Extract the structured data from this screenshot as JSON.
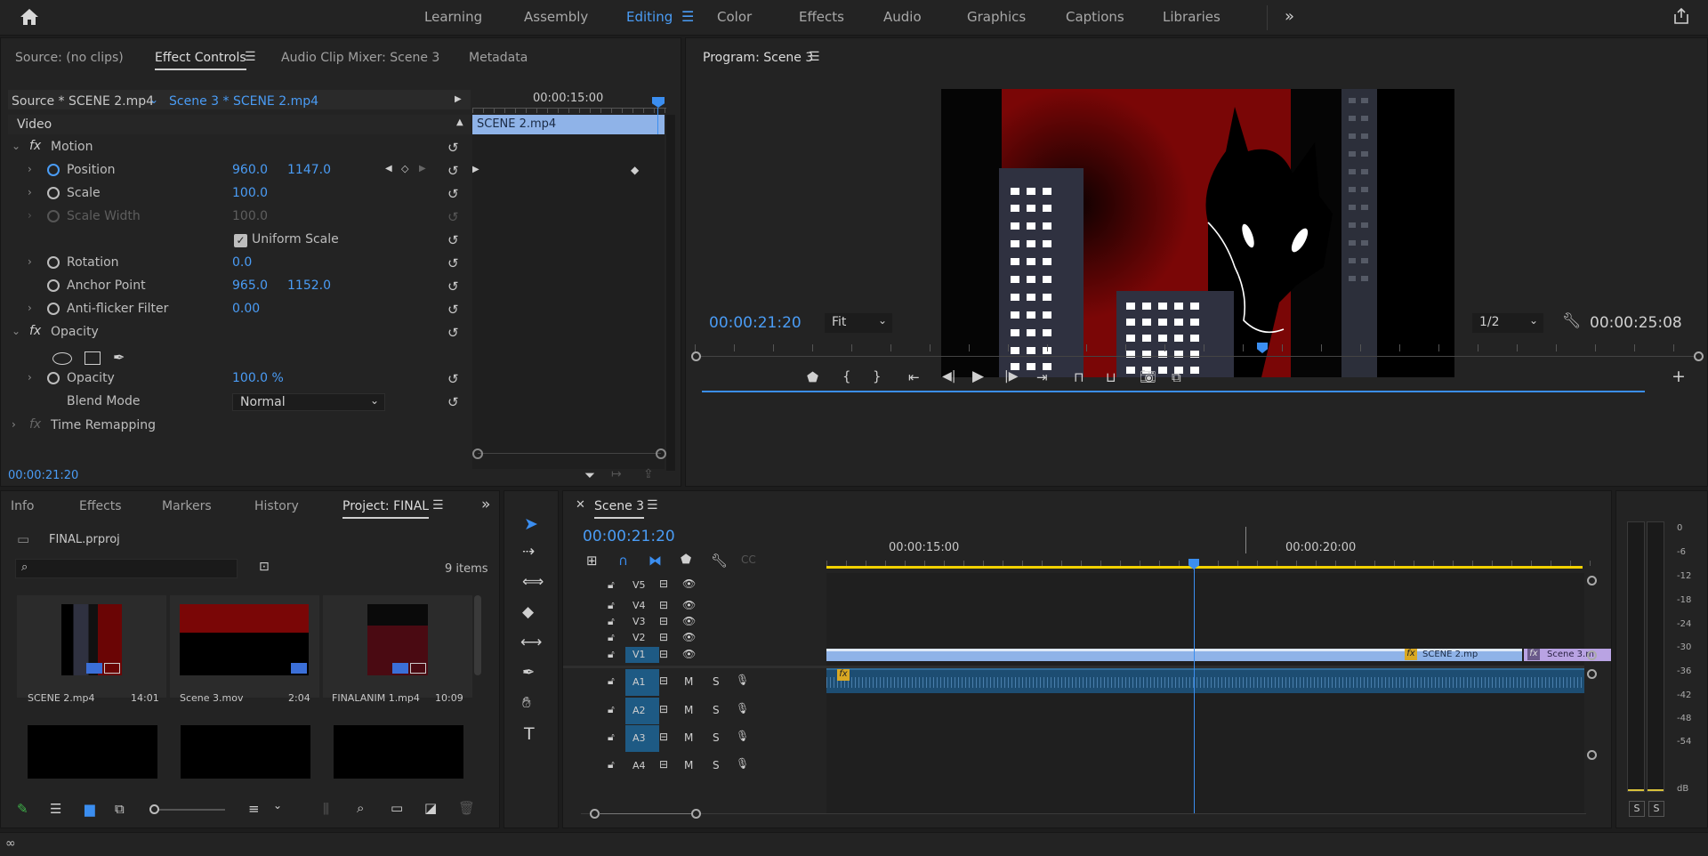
{
  "workspaces": {
    "items": [
      "Learning",
      "Assembly",
      "Editing",
      "Color",
      "Effects",
      "Audio",
      "Graphics",
      "Captions",
      "Libraries"
    ],
    "active": "Editing"
  },
  "source_panel": {
    "tabs": [
      "Source: (no clips)",
      "Effect Controls",
      "Audio Clip Mixer: Scene 3",
      "Metadata"
    ],
    "source_clip": "Source * SCENE 2.mp4",
    "seq_clip": "Scene 3 * SCENE 2.mp4",
    "ruler_time": "00:00:15:00",
    "clip_bar": "SCENE 2.mp4",
    "section_video": "Video",
    "fx_badge": "fx",
    "motion": "Motion",
    "position": {
      "label": "Position",
      "x": "960.0",
      "y": "1147.0"
    },
    "scale": {
      "label": "Scale",
      "value": "100.0"
    },
    "scale_width": {
      "label": "Scale Width",
      "value": "100.0"
    },
    "uniform_scale": "Uniform Scale",
    "rotation": {
      "label": "Rotation",
      "value": "0.0"
    },
    "anchor": {
      "label": "Anchor Point",
      "x": "965.0",
      "y": "1152.0"
    },
    "antiflicker": {
      "label": "Anti-flicker Filter",
      "value": "0.00"
    },
    "opacity_section": "Opacity",
    "opacity": {
      "label": "Opacity",
      "value": "100.0 %"
    },
    "blend": {
      "label": "Blend Mode",
      "value": "Normal"
    },
    "time_remap": "Time Remapping",
    "timecode": "00:00:21:20"
  },
  "program": {
    "title": "Program: Scene 3",
    "timecode": "00:00:21:20",
    "fit": "Fit",
    "resolution": "1/2",
    "duration": "00:00:25:08"
  },
  "project": {
    "tabs": [
      "Info",
      "Effects",
      "Markers",
      "History",
      "Project: FINAL"
    ],
    "file": "FINAL.prproj",
    "count": "9 items",
    "search_placeholder": "",
    "items": [
      {
        "name": "SCENE 2.mp4",
        "dur": "14:01"
      },
      {
        "name": "Scene 3.mov",
        "dur": "2:04"
      },
      {
        "name": "FINALANIM 1.mp4",
        "dur": "10:09"
      }
    ]
  },
  "timeline": {
    "title": "Scene 3",
    "timecode": "00:00:21:20",
    "ruler": [
      "00:00:15:00",
      "00:00:20:00"
    ],
    "video_tracks": [
      "V5",
      "V4",
      "V3",
      "V2",
      "V1"
    ],
    "audio_tracks": [
      "A1",
      "A2",
      "A3",
      "A4"
    ],
    "m": "M",
    "s": "S",
    "clip_v1": "SCENE 2.mp",
    "clip_v1b": "Scene 3.m",
    "fx": "fx"
  },
  "meter": {
    "scale": [
      "0",
      "-6",
      "-12",
      "-18",
      "-24",
      "-30",
      "-36",
      "-42",
      "-48",
      "-54",
      "dB"
    ],
    "solo": [
      "S",
      "S"
    ]
  },
  "colors": {
    "accent": "#4a9cf5",
    "clip_blue": "#8fb3e8",
    "clip_purple": "#b9a3e3",
    "playhead": "#3b8ef0"
  }
}
